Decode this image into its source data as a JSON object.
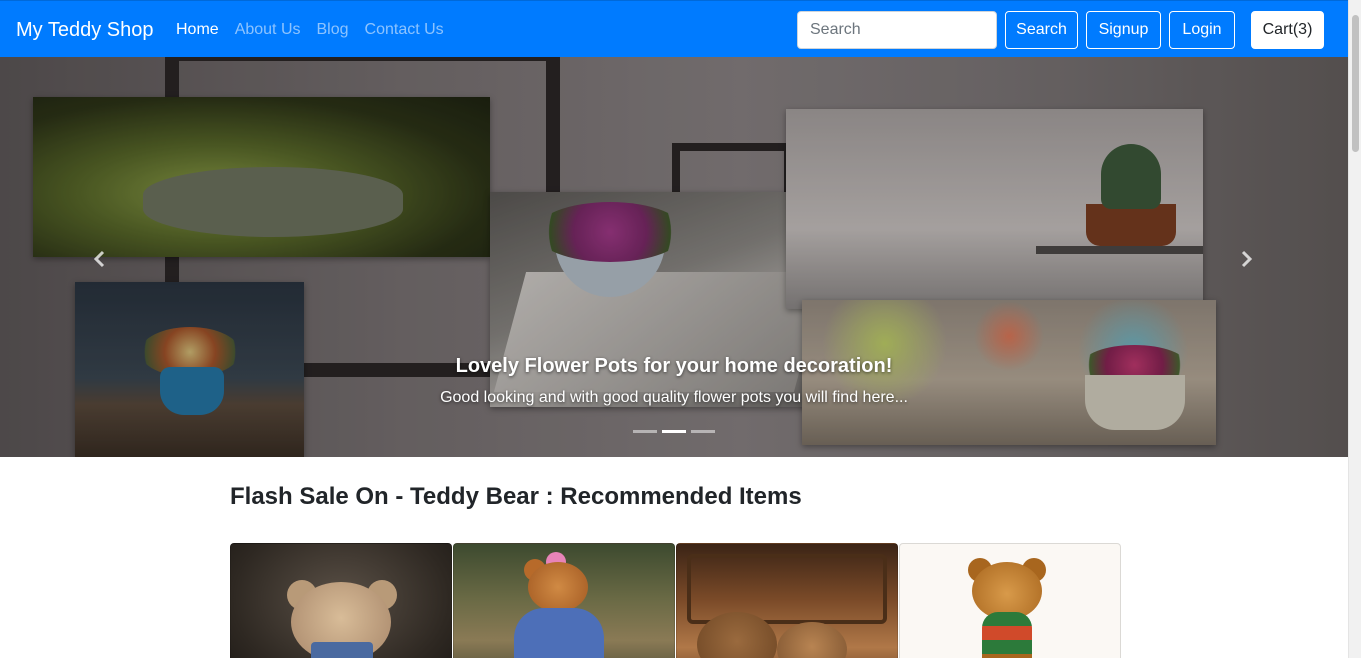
{
  "navbar": {
    "brand": "My Teddy Shop",
    "links": [
      {
        "label": "Home",
        "active": true
      },
      {
        "label": "About Us",
        "active": false
      },
      {
        "label": "Blog",
        "active": false
      },
      {
        "label": "Contact Us",
        "active": false
      }
    ],
    "search_placeholder": "Search",
    "search_button": "Search",
    "signup_button": "Signup",
    "login_button": "Login",
    "cart_button": "Cart(3)"
  },
  "carousel": {
    "caption_title": "Lovely Flower Pots for your home decoration!",
    "caption_text": "Good looking and with good quality flower pots you will find here...",
    "slide_count": 3,
    "active_slide": 2,
    "prev_icon": "chevron-left-icon",
    "next_icon": "chevron-right-icon"
  },
  "section": {
    "title": "Flash Sale On - Teddy Bear : Recommended Items"
  },
  "colors": {
    "navbar_bg": "#007bff",
    "text": "#212529"
  }
}
